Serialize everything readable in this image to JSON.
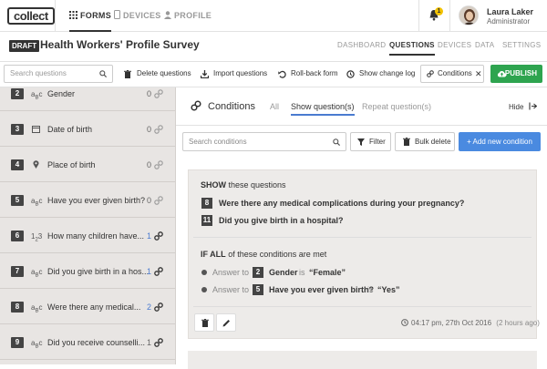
{
  "app": {
    "logo": "collect"
  },
  "nav": {
    "forms": "FORMS",
    "devices": "DEVICES",
    "profile": "PROFILE"
  },
  "user": {
    "name": "Laura Laker",
    "role": "Administrator",
    "notifications": "1"
  },
  "survey": {
    "status": "DRAFT",
    "title": "Health Workers' Profile Survey",
    "tabs": [
      "DASHBOARD",
      "QUESTIONS",
      "DEVICES",
      "DATA",
      "SETTINGS"
    ],
    "active_tab": "QUESTIONS"
  },
  "toolbar": {
    "search_placeholder": "Search questions",
    "delete": "Delete questions",
    "import": "Import questions",
    "rollback": "Roll-back form",
    "changelog": "Show change log",
    "conditions": "Conditions",
    "publish": "PUBLISH"
  },
  "questions": [
    {
      "num": "2",
      "type": "ABC",
      "text": "Gender",
      "count": "0"
    },
    {
      "num": "3",
      "type": "date",
      "text": "Date of birth",
      "count": "0"
    },
    {
      "num": "4",
      "type": "pin",
      "text": "Place of birth",
      "count": "0"
    },
    {
      "num": "5",
      "type": "ABC",
      "text": "Have you ever given birth?",
      "count": "0"
    },
    {
      "num": "6",
      "type": "123",
      "text": "How many children have...",
      "count": "1"
    },
    {
      "num": "7",
      "type": "ABC",
      "text": "Did you give birth in a hos...",
      "count": "1"
    },
    {
      "num": "8",
      "type": "ABC",
      "text": "Were there any medical...",
      "count": "2"
    },
    {
      "num": "9",
      "type": "ABC",
      "text": "Did you receive counselli...",
      "count": "1"
    }
  ],
  "conditions": {
    "title": "Conditions",
    "tabs": [
      "All",
      "Show question(s)",
      "Repeat question(s)"
    ],
    "active_tab": "Show question(s)",
    "hide": "Hide",
    "search_placeholder": "Search conditions",
    "filter": "Filter",
    "bulk_delete": "Bulk delete",
    "add": "+ Add new condition",
    "card": {
      "show_label": "SHOW",
      "show_rest": "these questions",
      "show_questions": [
        {
          "num": "8",
          "text": "Were there any medical complications during your pregnancy?"
        },
        {
          "num": "11",
          "text": "Did you give birth in a hospital?"
        }
      ],
      "if_label": "IF ALL",
      "if_rest": "of these conditions are met",
      "rules": [
        {
          "prefix": "Answer to",
          "num": "2",
          "question": "Gender",
          "op": "is",
          "value": "“Female”"
        },
        {
          "prefix": "Answer to",
          "num": "5",
          "question": "Have you ever given birth?",
          "op": "is",
          "value": "“Yes”"
        }
      ],
      "timestamp": "04:17 pm, 27th Oct 2016",
      "ago": "(2 hours ago)"
    }
  },
  "colors": {
    "publish": "#2ea44f",
    "accent": "#4a8ae0",
    "draft": "#333333"
  }
}
